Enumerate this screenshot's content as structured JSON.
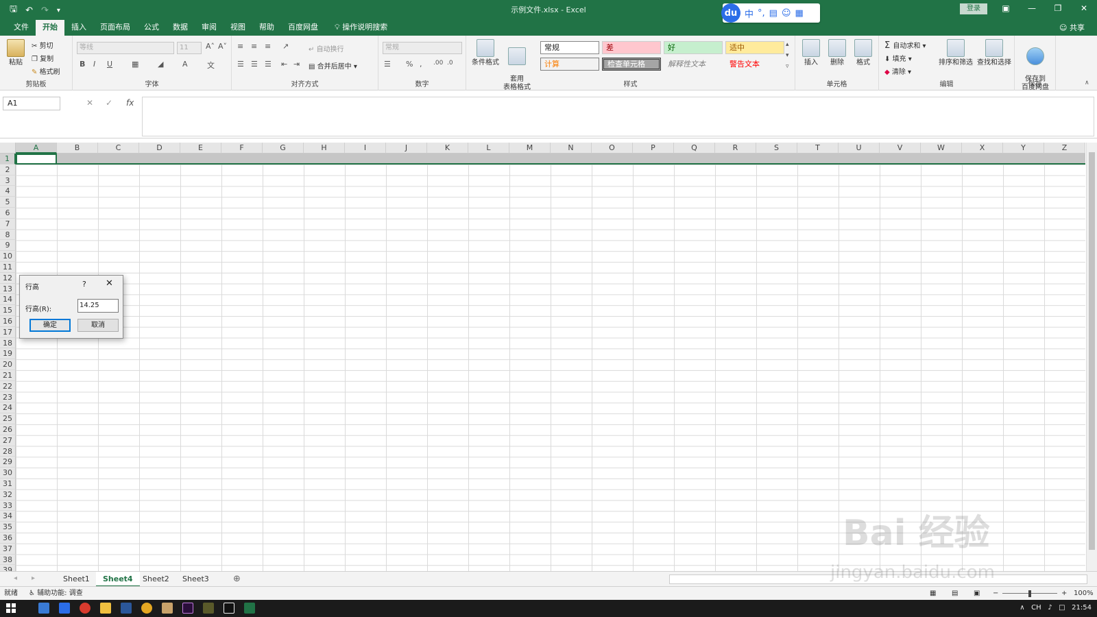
{
  "window": {
    "title": "示例文件.xlsx  -  Excel",
    "login": "登录",
    "share": "共享"
  },
  "ime": {
    "logo": "du",
    "mode": "中",
    "punct": "°,"
  },
  "tabs": [
    "文件",
    "开始",
    "插入",
    "页面布局",
    "公式",
    "数据",
    "审阅",
    "视图",
    "帮助",
    "百度网盘"
  ],
  "tab_search": "操作说明搜索",
  "ribbon": {
    "clipboard": {
      "paste": "粘贴",
      "cut": "剪切",
      "copy": "复制",
      "painter": "格式刷",
      "label": "剪贴板"
    },
    "font": {
      "name": "等线",
      "size": "11",
      "label": "字体"
    },
    "align": {
      "wrap": "自动换行",
      "merge": "合并后居中",
      "label": "对齐方式"
    },
    "number": {
      "format": "常规",
      "label": "数字"
    },
    "styles": {
      "cond": "条件格式",
      "table": "套用\n表格格式",
      "cells": [
        "常规",
        "差",
        "好",
        "适中",
        "计算",
        "检查单元格",
        "解释性文本",
        "警告文本"
      ],
      "label": "样式"
    },
    "cells": {
      "insert": "插入",
      "delete": "删除",
      "format": "格式",
      "label": "单元格"
    },
    "edit": {
      "autosum": "自动求和",
      "fill": "填充",
      "clear": "清除",
      "sort": "排序和筛选",
      "find": "查找和选择",
      "label": "编辑"
    },
    "save": {
      "save": "保存到\n百度网盘",
      "label": "保存"
    }
  },
  "formula_bar": {
    "namebox": "A1",
    "fx": "fx"
  },
  "columns": [
    "A",
    "B",
    "C",
    "D",
    "E",
    "F",
    "G",
    "H",
    "I",
    "J",
    "K",
    "L",
    "M",
    "N",
    "O",
    "P",
    "Q",
    "R",
    "S",
    "T",
    "U",
    "V",
    "W",
    "X",
    "Y",
    "Z"
  ],
  "rows": [
    "1",
    "2",
    "3",
    "4",
    "5",
    "6",
    "7",
    "8",
    "9",
    "10",
    "11",
    "12",
    "13",
    "14",
    "15",
    "16",
    "17",
    "18",
    "19",
    "20",
    "21",
    "22",
    "23",
    "24",
    "25",
    "26",
    "27",
    "28",
    "29",
    "30",
    "31",
    "32",
    "33",
    "34",
    "35",
    "36",
    "37",
    "38",
    "39"
  ],
  "sheets": [
    "Sheet1",
    "Sheet4",
    "Sheet2",
    "Sheet3"
  ],
  "active_sheet": "Sheet4",
  "status": {
    "ready": "就绪",
    "accessibility": "辅助功能: 调查",
    "zoom": "100%"
  },
  "taskbar": {
    "ime": "CH",
    "time": "21:54"
  },
  "dialog": {
    "title": "行高",
    "help": "?",
    "label": "行高(R):",
    "value": "14.25",
    "ok": "确定",
    "cancel": "取消"
  },
  "watermark": {
    "brand": "Bai 经验",
    "url": "jingyan.baidu.com"
  },
  "colors": {
    "accent": "#217346",
    "dialog_focus": "#0078d7"
  }
}
